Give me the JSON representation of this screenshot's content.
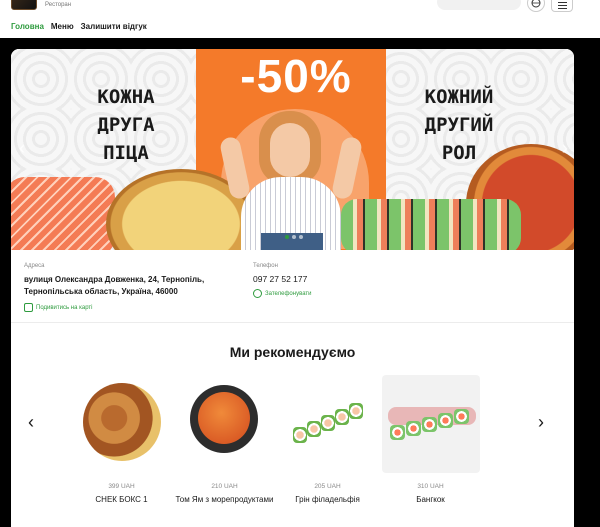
{
  "header": {
    "restaurant_label": "Ресторан",
    "nav": [
      {
        "label": "Головна",
        "active": true
      },
      {
        "label": "Меню",
        "active": false
      },
      {
        "label": "Залишити відгук",
        "active": false
      }
    ]
  },
  "banner": {
    "promo": "-50%",
    "left_text_1": "КОЖНА",
    "left_text_2": "ДРУГА ПІЦА",
    "right_text_1": "КОЖНИЙ",
    "right_text_2": "ДРУГИЙ РОЛ",
    "prev_icon": "chevron-left-icon",
    "next_icon": "chevron-right-icon"
  },
  "info": {
    "address_label": "Адреса",
    "address": "вулиця Олександра Довженка, 24, Тернопіль, Тернопільська область, Україна, 46000",
    "map_link": "Подивитись на карті",
    "phone_label": "Телефон",
    "phone": "097 27 52 177",
    "call_link": "Зателефонувати"
  },
  "recommendations": {
    "title": "Ми рекомендуємо",
    "items": [
      {
        "price": "399 UAH",
        "name": "СНЕК БОКС 1"
      },
      {
        "price": "210 UAH",
        "name": "Том Ям з морепродуктами"
      },
      {
        "price": "205 UAH",
        "name": "Грін філадельфія"
      },
      {
        "price": "310 UAH",
        "name": "Бангкок"
      }
    ]
  },
  "colors": {
    "accent": "#2e9b3e",
    "banner_orange": "#f47a2a"
  }
}
